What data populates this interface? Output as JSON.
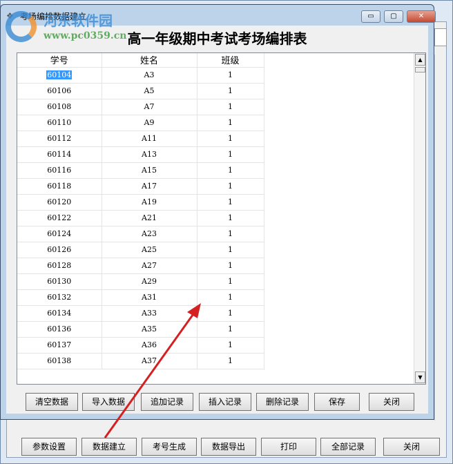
{
  "dialog": {
    "title": "考场编排数据建立",
    "heading": "高一年级期中考试考场编排表"
  },
  "window_buttons": {
    "minimize": "▭",
    "maximize": "▢",
    "close": "✕"
  },
  "table": {
    "headers": [
      "学号",
      "姓名",
      "班级"
    ],
    "rows": [
      [
        "60104",
        "A3",
        "1"
      ],
      [
        "60106",
        "A5",
        "1"
      ],
      [
        "60108",
        "A7",
        "1"
      ],
      [
        "60110",
        "A9",
        "1"
      ],
      [
        "60112",
        "A11",
        "1"
      ],
      [
        "60114",
        "A13",
        "1"
      ],
      [
        "60116",
        "A15",
        "1"
      ],
      [
        "60118",
        "A17",
        "1"
      ],
      [
        "60120",
        "A19",
        "1"
      ],
      [
        "60122",
        "A21",
        "1"
      ],
      [
        "60124",
        "A23",
        "1"
      ],
      [
        "60126",
        "A25",
        "1"
      ],
      [
        "60128",
        "A27",
        "1"
      ],
      [
        "60130",
        "A29",
        "1"
      ],
      [
        "60132",
        "A31",
        "1"
      ],
      [
        "60134",
        "A33",
        "1"
      ],
      [
        "60136",
        "A35",
        "1"
      ],
      [
        "60137",
        "A36",
        "1"
      ],
      [
        "60138",
        "A37",
        "1"
      ]
    ]
  },
  "dialog_buttons": [
    "清空数据",
    "导入数据",
    "追加记录",
    "插入记录",
    "删除记录",
    "保存",
    "关闭"
  ],
  "main_buttons": [
    "参数设置",
    "数据建立",
    "考号生成",
    "数据导出",
    "打印",
    "全部记录",
    "关闭"
  ],
  "watermark": {
    "name": "河东软件园",
    "url": "www.pc0359.cn"
  },
  "colors": {
    "selection": "#3399ff",
    "arrow": "#d42020"
  }
}
